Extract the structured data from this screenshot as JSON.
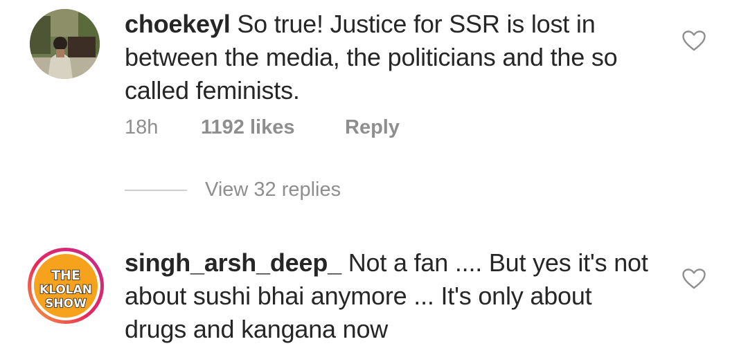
{
  "comments": [
    {
      "username": "choekeyl",
      "text": "So true! Justice for SSR is lost in between the media, the politicians and the so called feminists.",
      "time": "18h",
      "likes": "1192 likes",
      "reply_label": "Reply",
      "view_replies": "View 32 replies"
    },
    {
      "username": "singh_arsh_deep_",
      "text": "Not a fan .... But yes it's not about sushi bhai anymore ... It's only about drugs and kangana now",
      "avatar_logo": [
        "THE",
        "KLOLAN",
        "SHOW"
      ]
    }
  ]
}
